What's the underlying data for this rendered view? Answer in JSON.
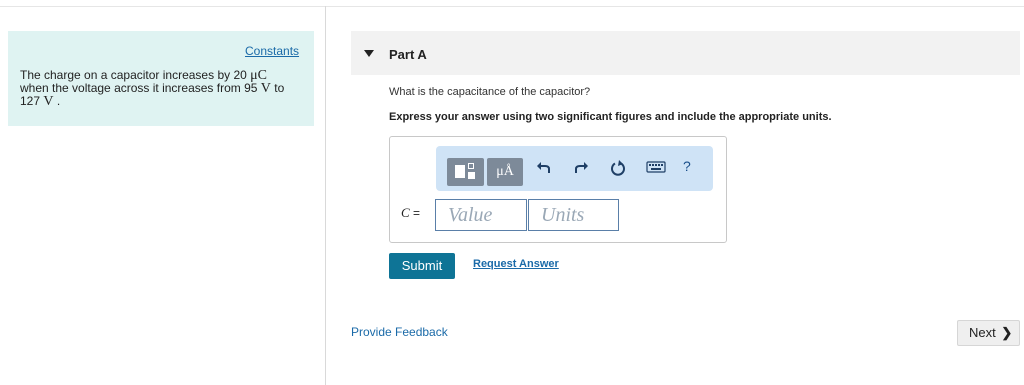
{
  "sidebar": {
    "constants_link": "Constants",
    "problem": {
      "t1": "The charge on a capacitor increases by 20 ",
      "m1": "μC",
      "t2": "when the voltage across it increases from 95 ",
      "m2": "V",
      "t3": " to",
      "t4": "127 ",
      "m3": "V",
      "t5": " ."
    }
  },
  "part": {
    "title": "Part A",
    "question": "What is the capacitance of the capacitor?",
    "instruction": "Express your answer using two significant figures and include the appropriate units."
  },
  "toolbar": {
    "units_label": "μÅ",
    "help_label": "?",
    "icons": [
      "templates-icon",
      "units-icon",
      "undo-icon",
      "redo-icon",
      "reset-icon",
      "keyboard-icon",
      "help-icon"
    ]
  },
  "answer": {
    "variable": "C",
    "equals": " =",
    "value_placeholder": "Value",
    "units_placeholder": "Units"
  },
  "actions": {
    "submit": "Submit",
    "request_answer": "Request Answer"
  },
  "footer": {
    "feedback": "Provide Feedback",
    "next": "Next",
    "next_chevron": "❯"
  },
  "colors": {
    "sidebar_bg": "#dff3f2",
    "link": "#1a6aa8",
    "submit_bg": "#0e7496",
    "toolbar_bg": "#cfe3f6"
  }
}
